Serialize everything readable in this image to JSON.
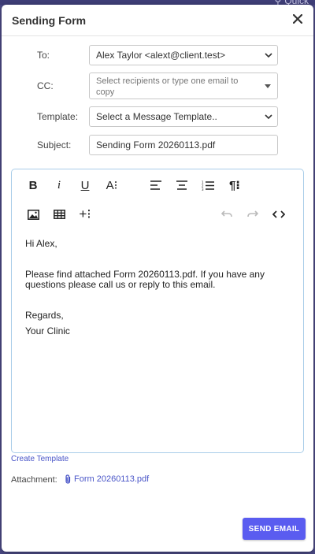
{
  "background": {
    "search_hint": "Quick"
  },
  "modal": {
    "title": "Sending Form",
    "to_label": "To:",
    "to_value": "Alex Taylor <alext@client.test>",
    "cc_label": "CC:",
    "cc_placeholder": "Select recipients or type one email to copy",
    "template_label": "Template:",
    "template_value": "Select a Message Template..",
    "subject_label": "Subject:",
    "subject_value": "Sending Form 20260113.pdf"
  },
  "toolbar": {
    "bold": "B",
    "italic": "i",
    "underline": "U",
    "font": "A⁝",
    "paragraph": "¶⁝",
    "insert": "+⁝"
  },
  "editor": {
    "greeting": "Hi Alex,",
    "body": "Please find attached Form 20260113.pdf. If you have any questions please call us or reply to this email.",
    "regards": "Regards,",
    "signature": "Your Clinic"
  },
  "footer": {
    "create_template": "Create Template",
    "attachment_label": "Attachment:",
    "attachment_file": "Form 20260113.pdf",
    "send_label": "SEND EMAIL"
  },
  "colors": {
    "accent": "#5a5cf0",
    "link": "#4a56c8",
    "backdrop": "#4b4a86"
  }
}
